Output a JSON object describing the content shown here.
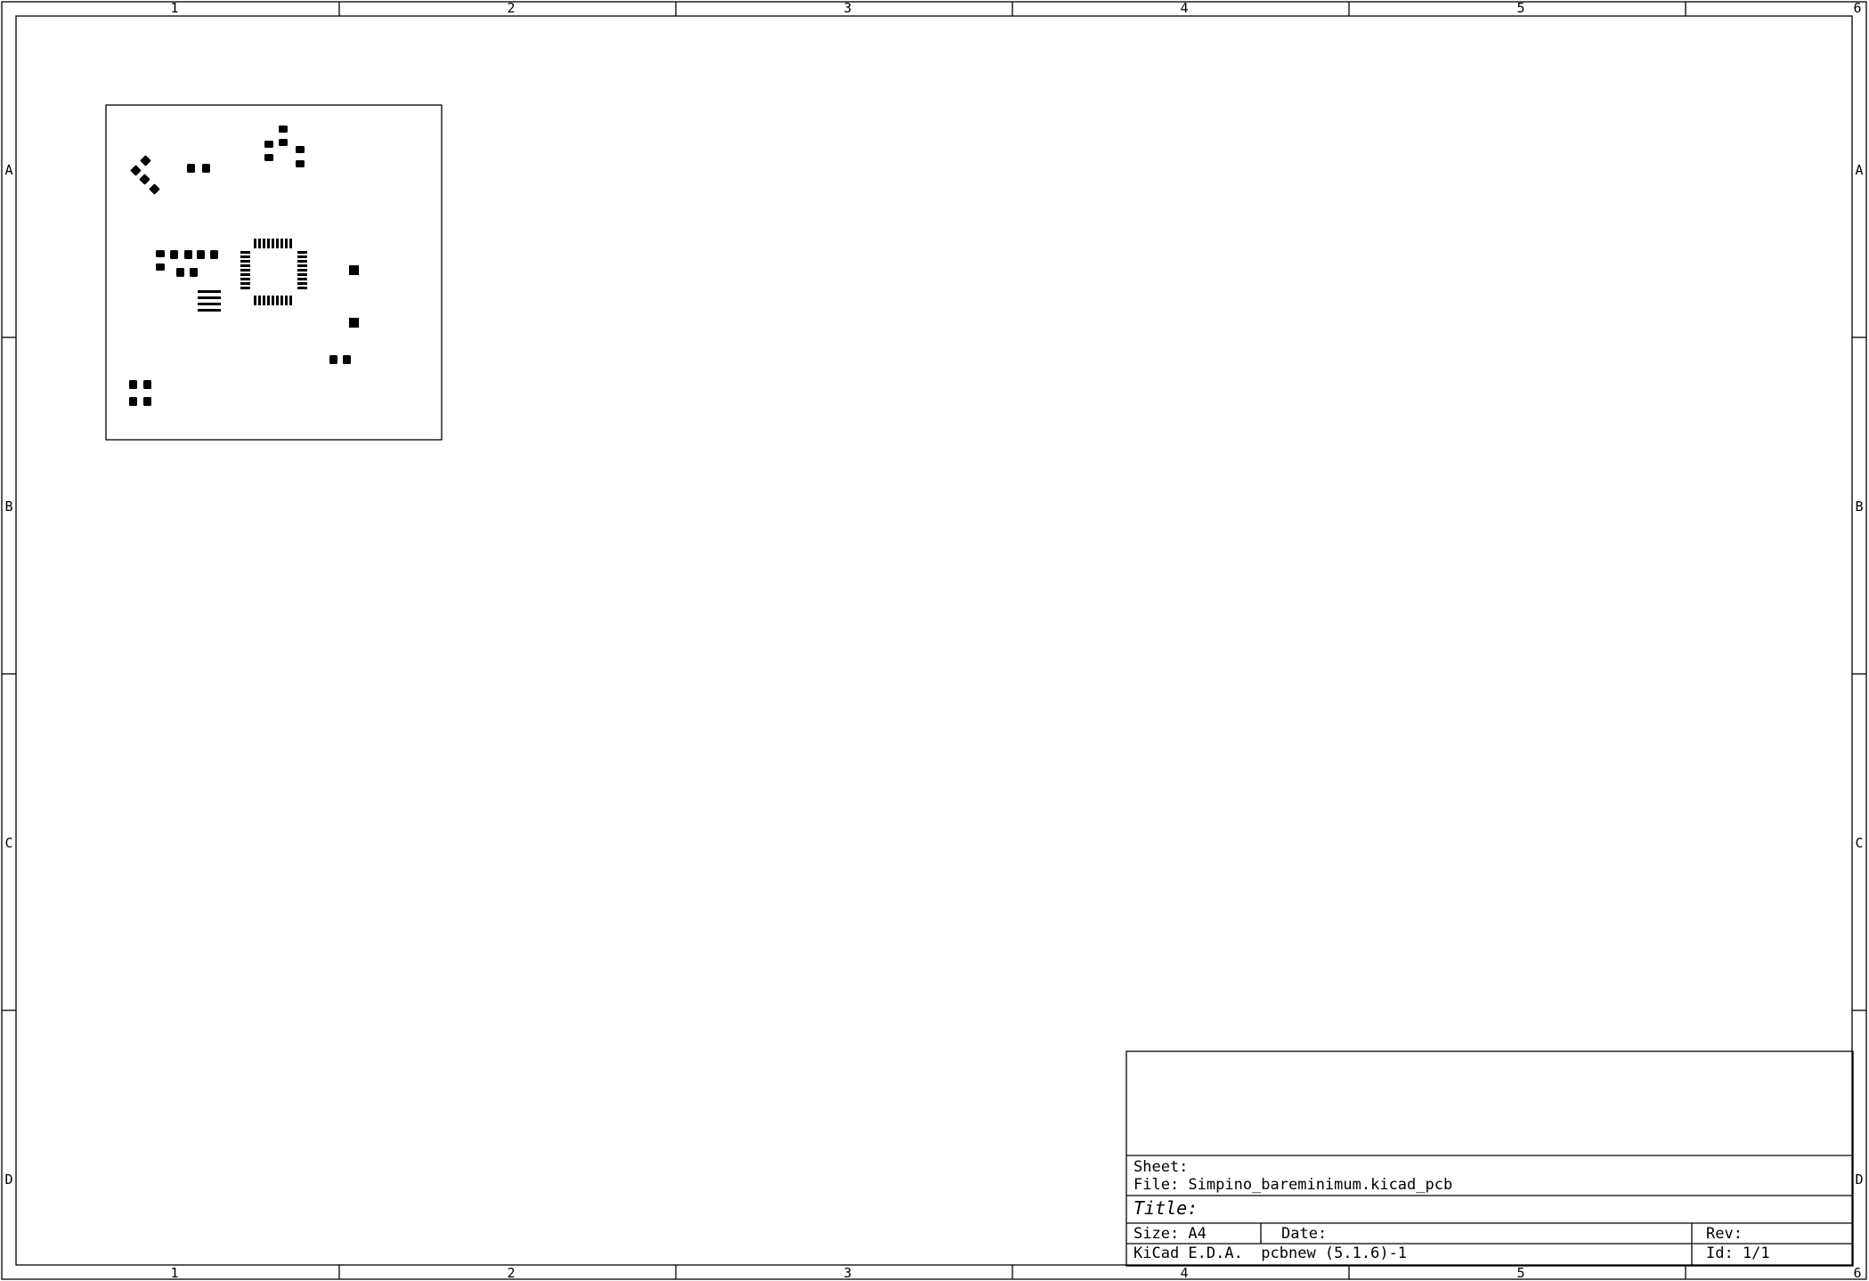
{
  "sheet_frame": {
    "column_labels": [
      "1",
      "2",
      "3",
      "4",
      "5",
      "6"
    ],
    "row_labels": [
      "A",
      "B",
      "C",
      "D"
    ]
  },
  "title_block": {
    "sheet_label": "Sheet:",
    "file_label": "File: Simpino_bareminimum.kicad_pcb",
    "title_label": "Title:",
    "size_label": "Size: A4",
    "date_label": "Date:",
    "rev_label": "Rev:",
    "software_label": "KiCad E.D.A.  pcbnew (5.1.6)-1",
    "id_label": "Id: 1/1"
  }
}
